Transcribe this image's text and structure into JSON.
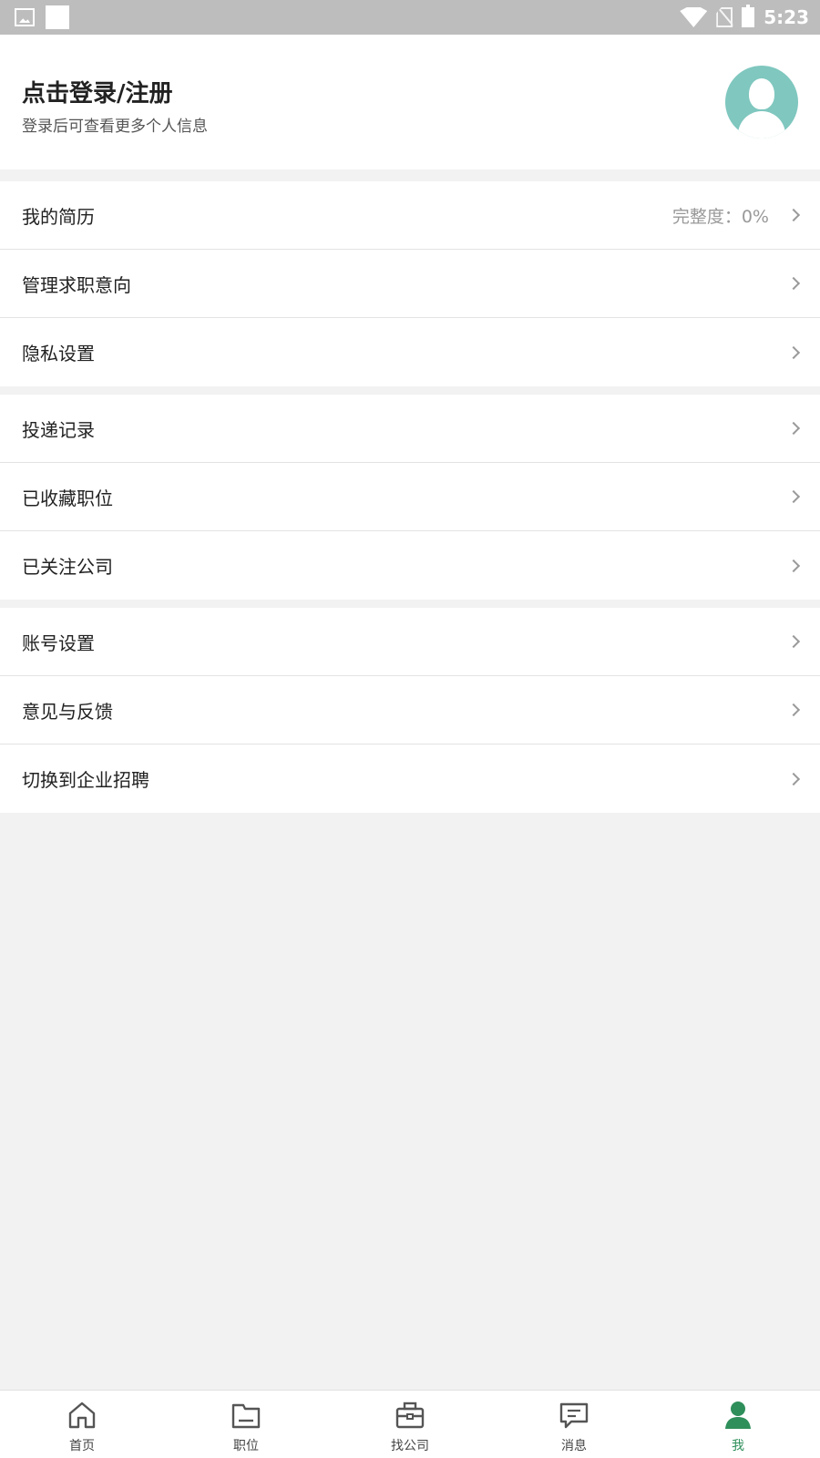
{
  "status_bar": {
    "time": "5:23"
  },
  "header": {
    "title": "点击登录/注册",
    "subtitle": "登录后可查看更多个人信息"
  },
  "groups": [
    [
      {
        "label": "我的简历",
        "value": "完整度：0%"
      },
      {
        "label": "管理求职意向"
      },
      {
        "label": "隐私设置"
      }
    ],
    [
      {
        "label": "投递记录"
      },
      {
        "label": "已收藏职位"
      },
      {
        "label": "已关注公司"
      }
    ],
    [
      {
        "label": "账号设置"
      },
      {
        "label": "意见与反馈"
      },
      {
        "label": "切换到企业招聘"
      }
    ]
  ],
  "bottom_nav": [
    {
      "label": "首页",
      "icon": "home-icon",
      "active": false
    },
    {
      "label": "职位",
      "icon": "folder-icon",
      "active": false
    },
    {
      "label": "找公司",
      "icon": "briefcase-icon",
      "active": false
    },
    {
      "label": "消息",
      "icon": "message-icon",
      "active": false
    },
    {
      "label": "我",
      "icon": "person-icon",
      "active": true
    }
  ],
  "colors": {
    "accent": "#2f8f5b",
    "avatar_bg": "#7fc7bf",
    "background": "#f2f2f2"
  }
}
